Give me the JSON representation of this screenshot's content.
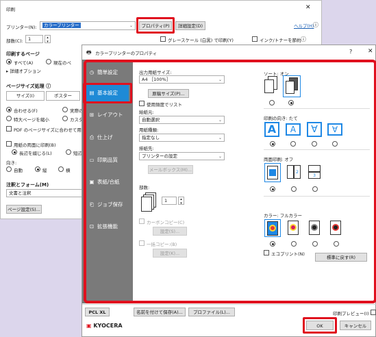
{
  "print_dialog": {
    "title": "印刷",
    "close_glyph": "✕",
    "printer_label": "プリンター(N):",
    "printer_value": "カラープリンター",
    "properties_button": "プロパティ(P)",
    "advanced_button": "詳細設定(D)",
    "help_link": "ヘルプ(H)",
    "help_glyph": "ⓘ",
    "copies_label": "部数(C):",
    "copies_value": "1",
    "grayscale_label": "グレースケール (白黒) で印刷(Y)",
    "save_ink_label": "インク/トナーを節約",
    "info_glyph": "ⓘ",
    "pages_heading": "印刷するページ",
    "all_pages": "すべて(A)",
    "current_page": "現在のペ",
    "detail_options": "▸ 詳細オプション",
    "sizing_heading": "ページサイズ処理 ⓘ",
    "size_button": "サイズ(I)",
    "poster_button": "ポスター",
    "fit": "合わせる(F)",
    "actual_size": "実際の",
    "shrink_oversized": "特大ページを縮小",
    "custom": "カスタム",
    "pdf_fit": "PDF のページサイズに合わせて用紙",
    "duplex_label": "用紙の両面に印刷(B)",
    "long_edge": "長辺を綴じる(L)",
    "short_edge": "短辺",
    "orientation_label": "向き:",
    "auto": "自動",
    "portrait": "縦",
    "landscape": "横",
    "comments_heading": "注釈とフォーム(M)",
    "comments_value": "文書と注釈",
    "page_setup_button": "ページ設定(S)..."
  },
  "props": {
    "title": "カラープリンターのプロパティ",
    "help_glyph": "?",
    "close_glyph": "✕",
    "sidebar": [
      {
        "icon": "◷",
        "label": "簡単設定"
      },
      {
        "icon": "▤",
        "label": "基本設定"
      },
      {
        "icon": "⊞",
        "label": "レイアウト"
      },
      {
        "icon": "⎙",
        "label": "仕上げ"
      },
      {
        "icon": "▭",
        "label": "印刷品質"
      },
      {
        "icon": "▣",
        "label": "表紙/合紙"
      },
      {
        "icon": "⎗",
        "label": "ジョブ保存"
      },
      {
        "icon": "⊡",
        "label": "拡張機能"
      }
    ],
    "paper_size_label": "出力用紙サイズ:",
    "paper_size_value": "A4 ［100%］",
    "original_size_button": "原稿サイズ(P)...",
    "use_chosen_list": "使用頻度でリスト",
    "paper_source_label": "給紙元:",
    "paper_source_value": "自動選択",
    "paper_type_label": "用紙種類:",
    "paper_type_value": "指定なし",
    "output_label": "排紙先:",
    "output_value": "プリンターの設定",
    "mailbox_button": "メールボックス(M)...",
    "copies_label": "部数:",
    "copies_value": "1",
    "carbon_copy": "カーボンコピー(C)",
    "carbon_settings": "設定(S)...",
    "batch_copy": "一括コピー:(B)",
    "batch_settings": "設定(K)...",
    "sort_label": "ソート: オン",
    "orientation_label": "印刷の向き: たて",
    "duplex_label": "両面印刷: オフ",
    "color_label": "カラー: フルカラー",
    "eco_print": "エコプリント(N)",
    "restore_button": "標準に戻す(R)",
    "pcl_button": "PCL XL",
    "save_name_button": "名前を付けて保存(A)...",
    "profile_button": "プロファイル(L)...",
    "preview_label": "印刷プレビュー(I)",
    "brand": "KYOCERA",
    "ok_button": "OK",
    "cancel_button": "キャンセル"
  },
  "colors": {
    "highlight_red": "#e0101e",
    "sidebar_gray": "#7a7a7a",
    "sidebar_active": "#1e8ad6",
    "icon_blue": "#1e88e5"
  }
}
